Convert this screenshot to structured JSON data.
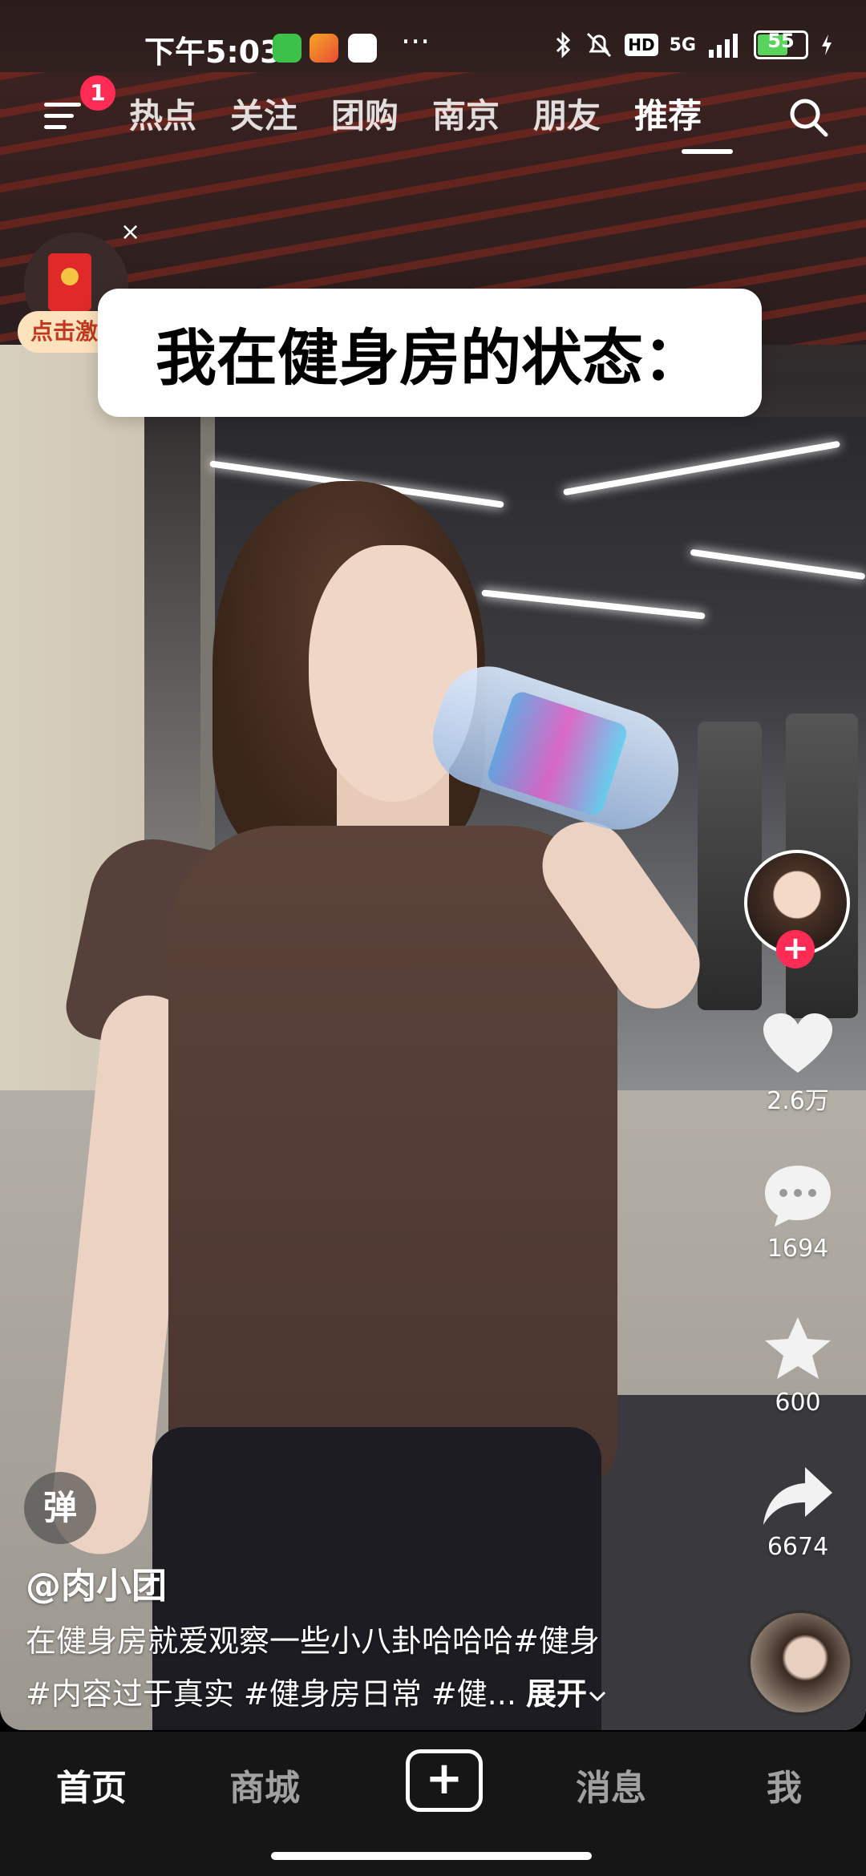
{
  "status_bar": {
    "time": "下午5:03",
    "more": "···",
    "network": "5G",
    "hd": "HD",
    "battery": "55"
  },
  "top_nav": {
    "notification_count": "1",
    "tabs": [
      "热点",
      "关注",
      "团购",
      "南京",
      "朋友",
      "推荐"
    ],
    "active_tab": "推荐"
  },
  "red_packet": {
    "label": "点击激活",
    "close": "×"
  },
  "video": {
    "caption": "我在健身房的状态："
  },
  "right_rail": {
    "like_count": "2.6万",
    "comment_count": "1694",
    "favorite_count": "600",
    "share_count": "6674",
    "follow_plus": "+"
  },
  "post": {
    "danmu_label": "弹",
    "author": "@肉小团",
    "description_line1": "在健身房就爱观察一些小八卦哈哈哈#健身",
    "description_line2": "#内容过于真实 #健身房日常 #健...",
    "expand_label": "展开"
  },
  "bottom_nav": {
    "home": "首页",
    "mall": "商城",
    "plus": "+",
    "messages": "消息",
    "me": "我"
  },
  "colors": {
    "accent": "#fe2c55",
    "nav_background": "#161616"
  }
}
